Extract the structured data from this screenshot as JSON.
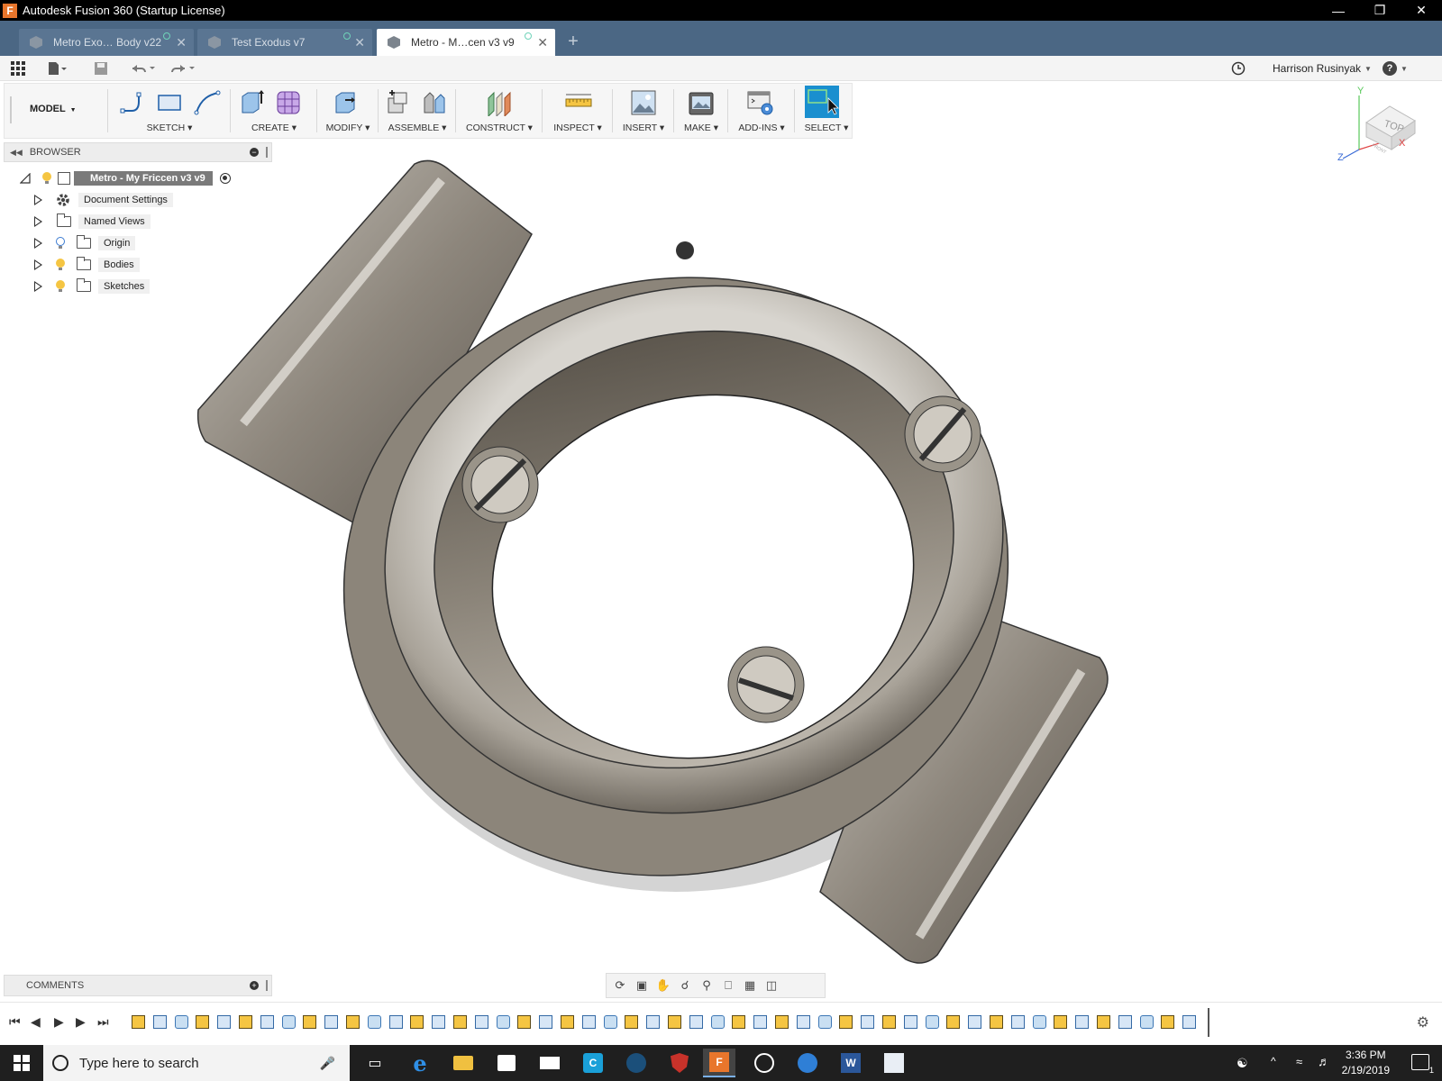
{
  "window": {
    "title": "Autodesk Fusion 360 (Startup License)",
    "app_icon_letter": "F"
  },
  "tabs": [
    {
      "label": "Metro Exo… Body v22"
    },
    {
      "label": "Test Exodus v7"
    },
    {
      "label": "Metro - M…cen v3 v9"
    }
  ],
  "quick_access": {
    "user": "Harrison Rusinyak",
    "help": "?"
  },
  "toolbar": {
    "workspace": "MODEL",
    "groups": [
      "SKETCH",
      "CREATE",
      "MODIFY",
      "ASSEMBLE",
      "CONSTRUCT",
      "INSPECT",
      "INSERT",
      "MAKE",
      "ADD-INS",
      "SELECT"
    ],
    "accent": "#1a8fcf"
  },
  "browser": {
    "header": "BROWSER",
    "root": "Metro - My Friccen v3 v9",
    "items": [
      {
        "label": "Document Settings",
        "icon": "gear-icon"
      },
      {
        "label": "Named Views",
        "icon": "folder-icon"
      },
      {
        "label": "Origin",
        "icon": "folder-icon"
      },
      {
        "label": "Bodies",
        "icon": "folder-icon"
      },
      {
        "label": "Sketches",
        "icon": "folder-icon"
      }
    ]
  },
  "viewcube": {
    "face": "TOP",
    "front_label": "FRONT",
    "axes": {
      "x": "X",
      "y": "Y",
      "z": "Z"
    }
  },
  "comments": {
    "header": "COMMENTS"
  },
  "taskbar": {
    "search_placeholder": "Type here to search",
    "time": "3:36 PM",
    "date": "2/19/2019",
    "notifications": "1"
  }
}
